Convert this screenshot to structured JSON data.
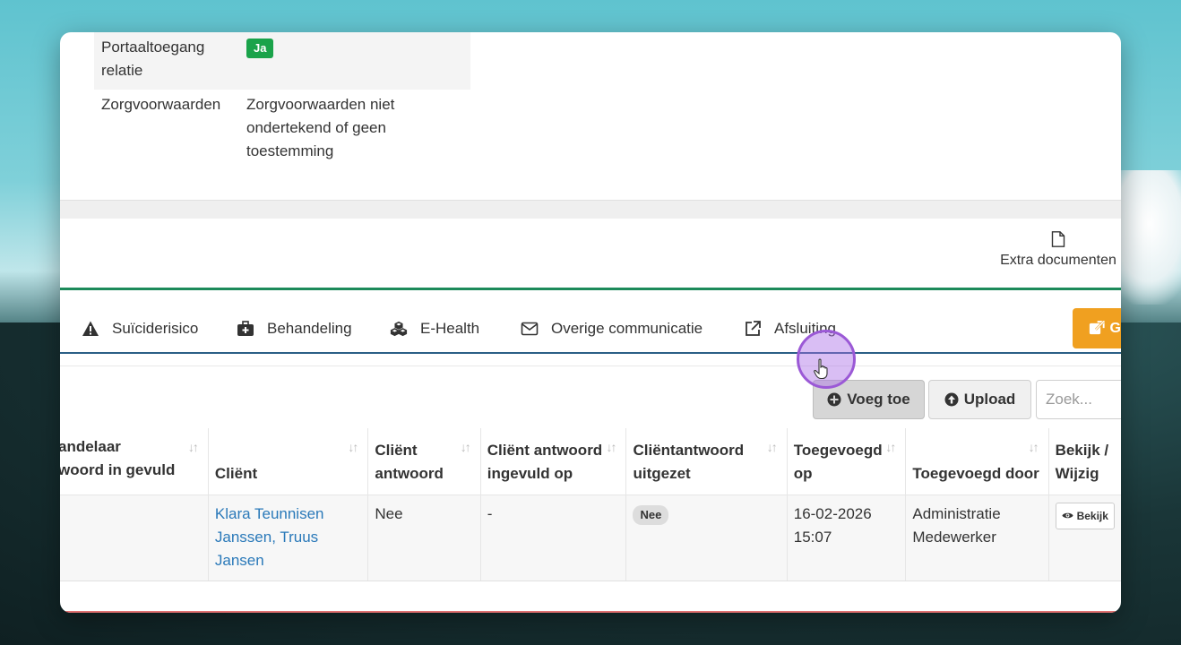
{
  "info_rows": [
    {
      "label": "Portaaltoegang relatie",
      "value": "Ja"
    },
    {
      "label": "Zorgvoorwaarden",
      "value": "Zorgvoorwaarden niet ondertekend of geen toestemming"
    }
  ],
  "extra_documents_label": "Extra documenten",
  "tabs": [
    {
      "label": "Suïciderisico",
      "icon": "warning-icon"
    },
    {
      "label": "Behandeling",
      "icon": "medkit-icon"
    },
    {
      "label": "E-Health",
      "icon": "cubes-icon"
    },
    {
      "label": "Overige communicatie",
      "icon": "envelope-icon"
    },
    {
      "label": "Afsluiting",
      "icon": "external-link-icon"
    }
  ],
  "orange_button_label": "G",
  "toolbar": {
    "add_label": "Voeg toe",
    "upload_label": "Upload",
    "search_placeholder": "Zoek..."
  },
  "table": {
    "columns": [
      "Behandelaar antwoord in gevuld",
      "Cliënt",
      "Cliënt antwoord",
      "Cliënt antwoord ingevuld op",
      "Cliëntantwoord uitgezet",
      "Toegevoegd op",
      "Toegevoegd door",
      "Bekijk / Wijzig"
    ],
    "visible_column_headers": [
      "andelaar\nwoord in gevuld",
      "Cliënt",
      "Cliënt antwoord",
      "Cliënt antwoord ingevuld op",
      "Cliëntantwoord uitgezet",
      "Toegevoegd op",
      "Toegevoegd door",
      "Bekijk / Wijzig"
    ],
    "rows": [
      {
        "behandelaar": "",
        "client": "Klara Teunnisen Janssen, Truus Jansen",
        "client_antwoord": "Nee",
        "ingevuld_op": "-",
        "uitgezet": "Nee",
        "toegevoegd_op": "16-02-2026 15:07",
        "toegevoegd_door": "Administratie Medewerker",
        "action": "Bekijk"
      }
    ]
  },
  "colors": {
    "accent_green": "#1c8a5a",
    "tab_border": "#2b5f86",
    "orange": "#f0a020",
    "badge_green": "#1aa34a",
    "link_blue": "#2a79b9",
    "cursor_purple": "#9b59d6"
  }
}
